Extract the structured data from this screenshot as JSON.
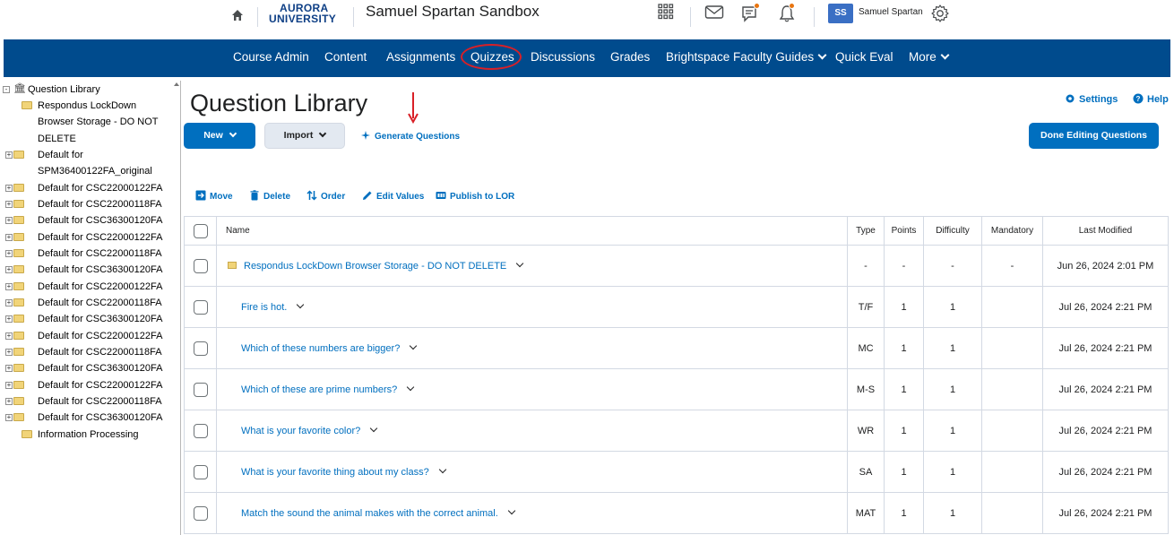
{
  "minibar": {
    "logo_line1": "AURORA",
    "logo_line2": "UNIVERSITY",
    "org_title": "Samuel Spartan Sandbox",
    "icons": [
      "home-icon",
      "apps-grid-icon",
      "mail-icon",
      "chat-icon",
      "bell-icon",
      "gear-icon"
    ],
    "avatar_initials": "SS",
    "username": "Samuel Spartan"
  },
  "nav": {
    "items": [
      {
        "label": "Course Admin"
      },
      {
        "label": "Content"
      },
      {
        "label": "Assignments"
      },
      {
        "label": "Quizzes"
      },
      {
        "label": "Discussions"
      },
      {
        "label": "Grades"
      },
      {
        "label": "Brightspace Faculty Guides"
      },
      {
        "label": "Quick Eval"
      },
      {
        "label": "More"
      }
    ],
    "highlight_color": "#d92027",
    "bar_color": "#004b8d"
  },
  "tree": {
    "root": "Question Library",
    "items": [
      "Respondus LockDown",
      "Browser Storage - DO NOT",
      "DELETE",
      "Default for",
      "SPM36400122FA_original",
      "Default for CSC22000122FA",
      "Default for CSC22000118FA",
      "Default for CSC36300120FA",
      "Default for CSC22000122FA",
      "Default for CSC22000118FA",
      "Default for CSC36300120FA",
      "Default for CSC22000122FA",
      "Default for CSC22000118FA",
      "Default for CSC36300120FA",
      "Default for CSC22000122FA",
      "Default for CSC22000118FA",
      "Default for CSC36300120FA",
      "Default for CSC22000122FA",
      "Default for CSC22000118FA",
      "Default for CSC36300120FA",
      "Information Processing"
    ]
  },
  "main": {
    "title": "Question Library",
    "settings": "Settings",
    "help": "Help",
    "new_button": "New",
    "import_button": "Import",
    "generate": "Generate Questions",
    "done_button": "Done Editing Questions",
    "toolbar": {
      "move": "Move",
      "delete": "Delete",
      "order": "Order",
      "edit_values": "Edit Values",
      "publish": "Publish to LOR"
    },
    "table": {
      "headers": {
        "name": "Name",
        "type": "Type",
        "points": "Points",
        "difficulty": "Difficulty",
        "mandatory": "Mandatory",
        "last_modified": "Last Modified"
      },
      "rows": [
        {
          "name": "Respondus LockDown Browser Storage - DO NOT DELETE",
          "type": "-",
          "points": "-",
          "difficulty": "-",
          "mandatory": "-",
          "modified": "Jun 26, 2024 2:01 PM"
        },
        {
          "name": "Fire is hot.",
          "type": "T/F",
          "points": "1",
          "difficulty": "1",
          "mandatory": "",
          "modified": "Jul 26, 2024 2:21 PM"
        },
        {
          "name": "Which of these numbers are bigger?",
          "type": "MC",
          "points": "1",
          "difficulty": "1",
          "mandatory": "",
          "modified": "Jul 26, 2024 2:21 PM"
        },
        {
          "name": "Which of these are prime numbers?",
          "type": "M-S",
          "points": "1",
          "difficulty": "1",
          "mandatory": "",
          "modified": "Jul 26, 2024 2:21 PM"
        },
        {
          "name": "What is your favorite color?",
          "type": "WR",
          "points": "1",
          "difficulty": "1",
          "mandatory": "",
          "modified": "Jul 26, 2024 2:21 PM"
        },
        {
          "name": "What is your favorite thing about my class?",
          "type": "SA",
          "points": "1",
          "difficulty": "1",
          "mandatory": "",
          "modified": "Jul 26, 2024 2:21 PM"
        },
        {
          "name": "Match the sound the animal makes with the correct animal.",
          "type": "MAT",
          "points": "1",
          "difficulty": "1",
          "mandatory": "",
          "modified": "Jul 26, 2024 2:21 PM"
        }
      ]
    }
  }
}
